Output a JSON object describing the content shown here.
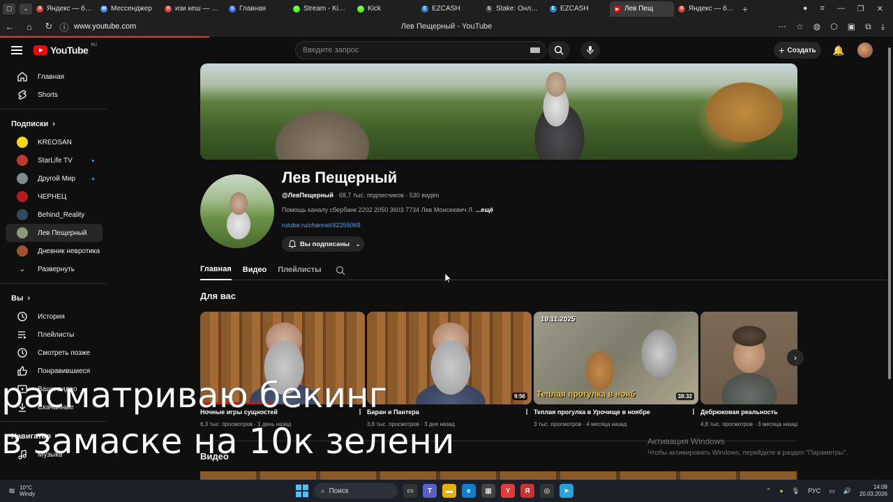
{
  "browser": {
    "tabs": [
      {
        "label": "Яндекс — быст",
        "color": "#e53935",
        "icon": "Я"
      },
      {
        "label": "Мессенджер",
        "color": "#3d8bfd",
        "icon": "M"
      },
      {
        "label": "изи кеш — Янд",
        "color": "#e53935",
        "icon": "Я"
      },
      {
        "label": "Главная",
        "color": "#3d6cff",
        "icon": "II"
      },
      {
        "label": "Stream - Kick D",
        "color": "#53fc18",
        "icon": "K"
      },
      {
        "label": "Kick",
        "color": "#53fc18",
        "icon": "K"
      },
      {
        "label": "EZCASH",
        "color": "#2f7bd6",
        "icon": "E"
      },
      {
        "label": "Stake: Онлайн",
        "color": "#444",
        "icon": "S"
      },
      {
        "label": "EZCASH",
        "color": "#2f7bd6",
        "icon": "E"
      },
      {
        "label": "Лев Пещ",
        "color": "#ff0000",
        "icon": "▶"
      },
      {
        "label": "Яндекс — быст",
        "color": "#e53935",
        "icon": "Я"
      }
    ],
    "active_tab_index": 9,
    "url": "www.youtube.com",
    "page_title": "Лев Пещерный - YouTube"
  },
  "masthead": {
    "logo_text": "YouTube",
    "region": "RU",
    "search_placeholder": "Введите запрос",
    "create_label": "Создать"
  },
  "sidebar": {
    "top": [
      {
        "label": "Главная",
        "icon": "home-icon"
      },
      {
        "label": "Shorts",
        "icon": "shorts-icon"
      }
    ],
    "subscriptions_title": "Подписки",
    "subscriptions": [
      {
        "label": "KREOSAN",
        "color": "#f5d90a",
        "dot": false
      },
      {
        "label": "StarLife TV",
        "color": "#c0392b",
        "dot": true
      },
      {
        "label": "Другой Мир",
        "color": "#7f8c8d",
        "dot": true
      },
      {
        "label": "ЧЕРНЕЦ",
        "color": "#b71c1c",
        "dot": false
      },
      {
        "label": "Behind_Reality",
        "color": "#34495e",
        "dot": false
      },
      {
        "label": "Лев Пещерный",
        "color": "#8d9a7a",
        "dot": false,
        "active": true
      },
      {
        "label": "Дневник невротика",
        "color": "#a0522d",
        "dot": false
      }
    ],
    "expand_label": "Развернуть",
    "you_title": "Вы",
    "you_items": [
      {
        "label": "История",
        "icon": "history-icon"
      },
      {
        "label": "Плейлисты",
        "icon": "playlists-icon"
      },
      {
        "label": "Смотреть позже",
        "icon": "watch-later-icon"
      },
      {
        "label": "Понравившиеся",
        "icon": "like-icon"
      },
      {
        "label": "Ваши видео",
        "icon": "your-videos-icon"
      },
      {
        "label": "Скачанные",
        "icon": "download-icon"
      }
    ],
    "navigator_title": "Навигатор",
    "navigator_items": [
      {
        "label": "Музыка",
        "icon": "music-icon"
      }
    ]
  },
  "channel": {
    "name": "Лев Пещерный",
    "handle": "@ЛевПещерный",
    "subscribers": "68,7 тыс. подписчиков",
    "videos_count": "530 видео",
    "description": "Помощь каналу сбербанк 2202 2050 3603 7734 Лев Моисеевич Л.",
    "more": "...ещё",
    "link": "rutube.ru/channel/42255069",
    "subscribed_label": "Вы подписаны",
    "tabs": [
      "Главная",
      "Видео",
      "Плейлисты"
    ]
  },
  "for_you": {
    "title": "Для вас",
    "videos": [
      {
        "title": "Ночные игры сущностей",
        "views": "6,3 тыс. просмотров",
        "age": "1 день назад",
        "duration": "",
        "progress": 0.45,
        "thumb": "wood"
      },
      {
        "title": "Баран и Пантера",
        "views": "3,8 тыс. просмотров",
        "age": "3 дня назад",
        "duration": "9:56",
        "progress": 0,
        "thumb": "wood"
      },
      {
        "title": "Теплая прогулка в Урочище в ноябре",
        "views": "3 тыс. просмотров",
        "age": "4 месяца назад",
        "duration": "38:32",
        "progress": 0,
        "thumb": "dog",
        "caption": "Теплая прогулка в нояб",
        "date_overlay": "19.11.2025"
      },
      {
        "title": "Дебрюковая реальность",
        "views": "4,8 тыс. просмотров",
        "age": "3 месяца назад",
        "duration": "",
        "progress": 0,
        "thumb": "cap"
      }
    ]
  },
  "videos_section_title": "Видео",
  "overlay": {
    "line1": "расматриваю бекинг",
    "line2": "в замаске  на 10к зелени"
  },
  "activation": {
    "line1": "Активация Windows",
    "line2": "Чтобы активировать Windows, перейдите в раздел \"Параметры\"."
  },
  "taskbar": {
    "temp": "10°C",
    "weather": "Windy",
    "search_label": "Поиск",
    "lang": "РУС",
    "time": "14:08",
    "date": "20.03.2026"
  }
}
